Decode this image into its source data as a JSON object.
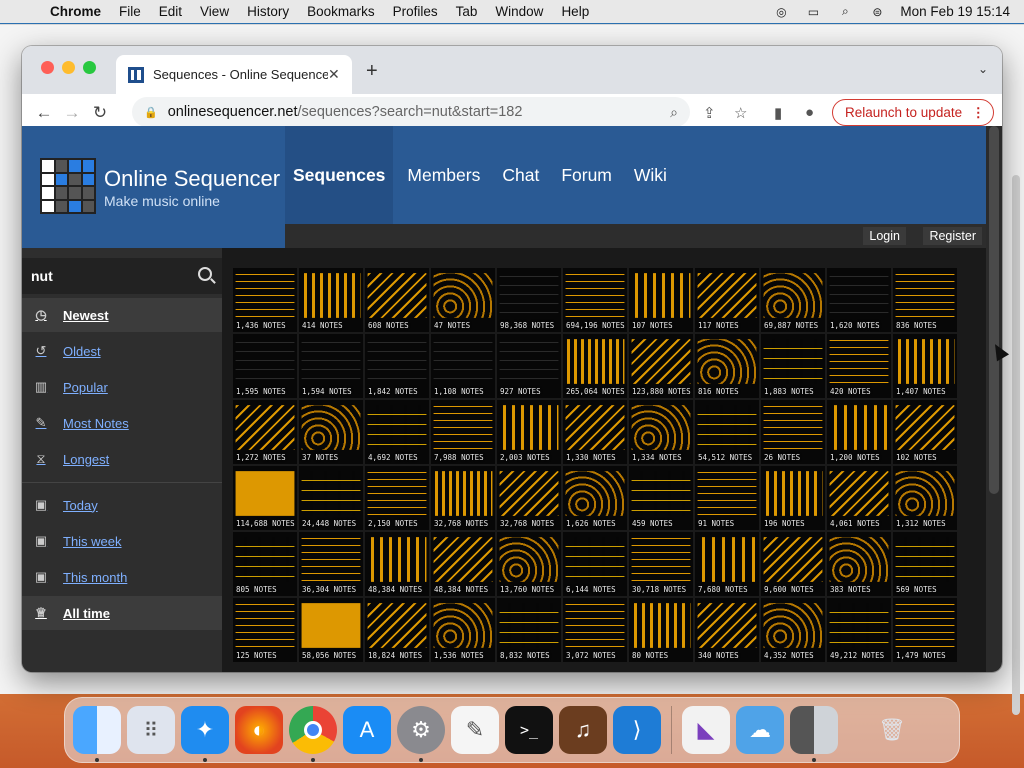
{
  "menubar": {
    "app": "Chrome",
    "items": [
      "File",
      "Edit",
      "View",
      "History",
      "Bookmarks",
      "Profiles",
      "Tab",
      "Window",
      "Help"
    ],
    "clock": "Mon Feb 19  15:14"
  },
  "browser": {
    "tab_title": "Sequences - Online Sequencer",
    "url_host": "onlinesequencer.net",
    "url_path": "/sequences?search=nut&start=182",
    "relaunch_label": "Relaunch to update"
  },
  "site": {
    "title": "Online Sequencer",
    "subtitle": "Make music online",
    "nav": [
      "Sequences",
      "Members",
      "Chat",
      "Forum",
      "Wiki"
    ],
    "active_nav": "Sequences",
    "login": "Login",
    "register": "Register"
  },
  "sidebar": {
    "search_value": "nut",
    "items": [
      {
        "label": "Newest",
        "icon": "clock-icon",
        "selected": true
      },
      {
        "label": "Oldest",
        "icon": "history-icon",
        "selected": false
      },
      {
        "label": "Popular",
        "icon": "chart-icon",
        "selected": false
      },
      {
        "label": "Most Notes",
        "icon": "pencil-icon",
        "selected": false
      },
      {
        "label": "Longest",
        "icon": "hourglass-icon",
        "selected": false
      },
      {
        "label": "Today",
        "icon": "calendar-icon",
        "selected": false
      },
      {
        "label": "This week",
        "icon": "calendar-icon",
        "selected": false
      },
      {
        "label": "This month",
        "icon": "calendar-icon",
        "selected": false
      },
      {
        "label": "All time",
        "icon": "trophy-icon",
        "selected": true
      }
    ]
  },
  "sequences": [
    "1,436 NOTES",
    "414 NOTES",
    "608 NOTES",
    "47 NOTES",
    "98,368 NOTES",
    "694,196 NOTES",
    "107 NOTES",
    "117 NOTES",
    "69,887 NOTES",
    "1,620 NOTES",
    "836 NOTES",
    "1,595 NOTES",
    "1,594 NOTES",
    "1,842 NOTES",
    "1,108 NOTES",
    "927 NOTES",
    "265,064 NOTES",
    "123,880 NOTES",
    "816 NOTES",
    "1,883 NOTES",
    "420 NOTES",
    "1,407 NOTES",
    "1,272 NOTES",
    "37 NOTES",
    "4,692 NOTES",
    "7,988 NOTES",
    "2,003 NOTES",
    "1,330 NOTES",
    "1,334 NOTES",
    "54,512 NOTES",
    "26 NOTES",
    "1,200 NOTES",
    "102 NOTES",
    "114,688 NOTES",
    "24,448 NOTES",
    "2,150 NOTES",
    "32,768 NOTES",
    "32,768 NOTES",
    "1,626 NOTES",
    "459 NOTES",
    "91 NOTES",
    "196 NOTES",
    "4,061 NOTES",
    "1,312 NOTES",
    "805 NOTES",
    "36,304 NOTES",
    "48,384 NOTES",
    "48,384 NOTES",
    "13,760 NOTES",
    "6,144 NOTES",
    "30,718 NOTES",
    "7,680 NOTES",
    "9,600 NOTES",
    "383 NOTES",
    "569 NOTES",
    "125 NOTES",
    "58,056 NOTES",
    "18,824 NOTES",
    "1,536 NOTES",
    "8,832 NOTES",
    "3,072 NOTES",
    "80 NOTES",
    "340 NOTES",
    "4,352 NOTES",
    "49,212 NOTES",
    "1,479 NOTES"
  ],
  "colors": {
    "accent": "#f5a800",
    "header": "#2a5a94",
    "page_bg": "#1a1a1a"
  }
}
